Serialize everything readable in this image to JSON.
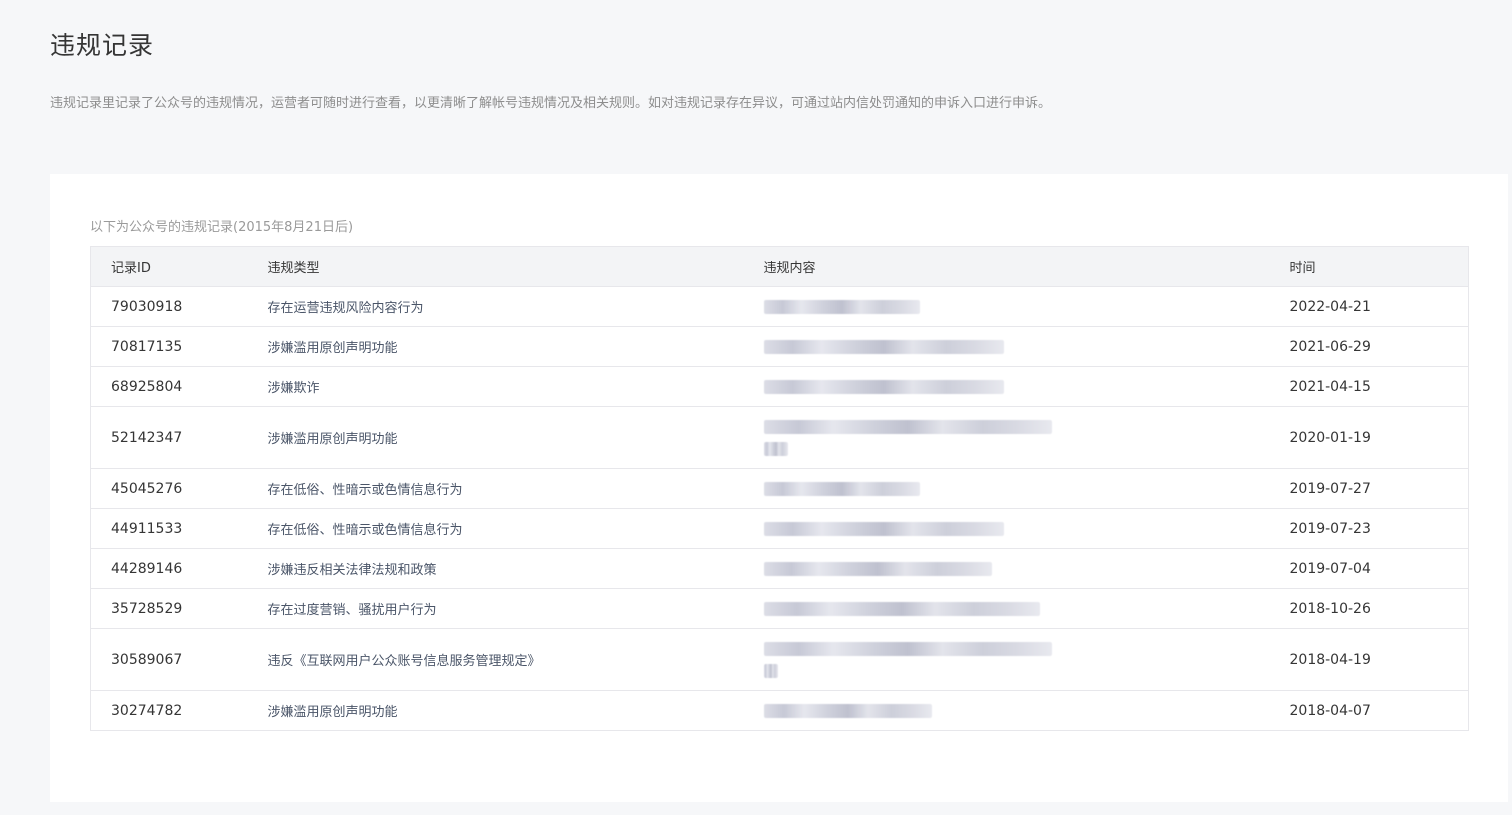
{
  "page": {
    "title": "违规记录",
    "description": "违规记录里记录了公众号的违规情况，运营者可随时进行查看，以更清晰了解帐号违规情况及相关规则。如对违规记录存在异议，可通过站内信处罚通知的申诉入口进行申诉。"
  },
  "table": {
    "caption": "以下为公众号的违规记录(2015年8月21日后)",
    "columns": [
      "记录ID",
      "违规类型",
      "违规内容",
      "时间"
    ],
    "rows": [
      {
        "id": "79030918",
        "type": "存在运营违规风险内容行为",
        "date": "2022-04-21"
      },
      {
        "id": "70817135",
        "type": "涉嫌滥用原创声明功能",
        "date": "2021-06-29"
      },
      {
        "id": "68925804",
        "type": "涉嫌欺诈",
        "date": "2021-04-15"
      },
      {
        "id": "52142347",
        "type": "涉嫌滥用原创声明功能",
        "date": "2020-01-19"
      },
      {
        "id": "45045276",
        "type": "存在低俗、性暗示或色情信息行为",
        "date": "2019-07-27"
      },
      {
        "id": "44911533",
        "type": "存在低俗、性暗示或色情信息行为",
        "date": "2019-07-23"
      },
      {
        "id": "44289146",
        "type": "涉嫌违反相关法律法规和政策",
        "date": "2019-07-04"
      },
      {
        "id": "35728529",
        "type": "存在过度营销、骚扰用户行为",
        "date": "2018-10-26"
      },
      {
        "id": "30589067",
        "type": "违反《互联网用户公众账号信息服务管理规定》",
        "date": "2018-04-19"
      },
      {
        "id": "30274782",
        "type": "涉嫌滥用原创声明功能",
        "date": "2018-04-07"
      }
    ]
  }
}
